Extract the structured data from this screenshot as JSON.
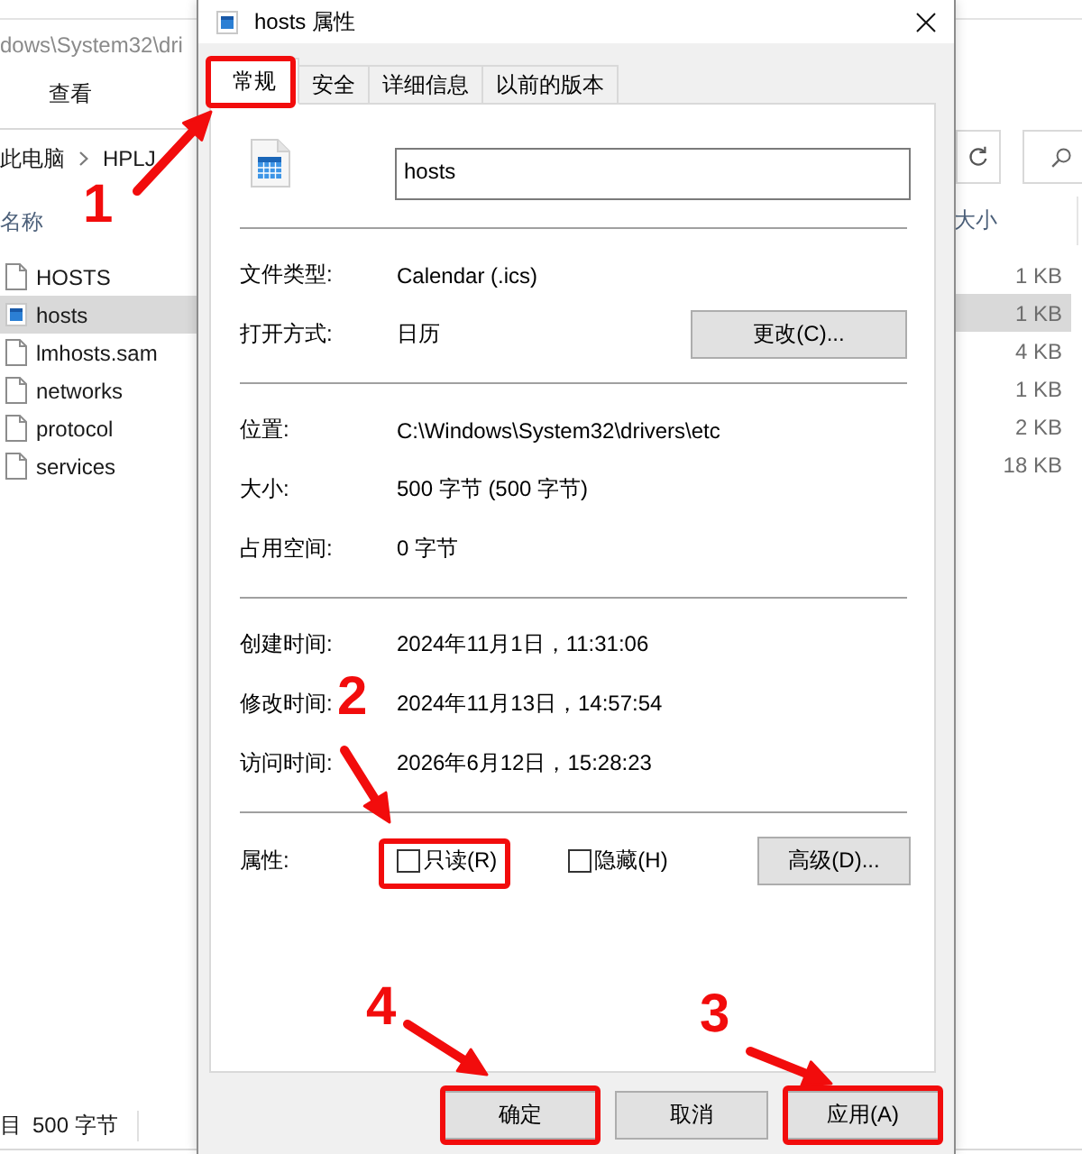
{
  "explorer": {
    "title": "dows\\System32\\dri",
    "ribbon_tabs": [
      "查看"
    ],
    "breadcrumb": [
      "此电脑",
      "HPLJ"
    ],
    "columns": [
      "名称",
      "大小"
    ],
    "files": [
      {
        "name": "HOSTS",
        "kind": "document",
        "size": "1 KB",
        "selected": false
      },
      {
        "name": "hosts",
        "kind": "calendar",
        "size": "1 KB",
        "selected": true
      },
      {
        "name": "lmhosts.sam",
        "kind": "document",
        "size": "4 KB",
        "selected": false
      },
      {
        "name": "networks",
        "kind": "document",
        "size": "1 KB",
        "selected": false
      },
      {
        "name": "protocol",
        "kind": "document",
        "size": "2 KB",
        "selected": false
      },
      {
        "name": "services",
        "kind": "document",
        "size": "18 KB",
        "selected": false
      }
    ],
    "status_bar": [
      "目",
      "500 字节"
    ]
  },
  "dialog": {
    "title": "hosts 属性",
    "tabs": [
      {
        "label": "常规",
        "selected": true,
        "highlighted": true
      },
      {
        "label": "安全",
        "selected": false,
        "highlighted": false
      },
      {
        "label": "详细信息",
        "selected": false,
        "highlighted": false
      },
      {
        "label": "以前的版本",
        "selected": false,
        "highlighted": false
      }
    ],
    "file_name": "hosts",
    "sections": [
      {
        "rows": [
          {
            "label": "文件类型:",
            "value": "Calendar (.ics)"
          },
          {
            "label": "打开方式:",
            "value": "日历",
            "button": "更改(C)..."
          }
        ]
      },
      {
        "rows": [
          {
            "label": "位置:",
            "value": "C:\\Windows\\System32\\drivers\\etc"
          },
          {
            "label": "大小:",
            "value": "500 字节 (500 字节)"
          },
          {
            "label": "占用空间:",
            "value": "0 字节"
          }
        ]
      },
      {
        "rows": [
          {
            "label": "创建时间:",
            "value": "2024年11月1日，11:31:06"
          },
          {
            "label": "修改时间:",
            "value": "2024年11月13日，14:57:54"
          },
          {
            "label": "访问时间:",
            "value": "2026年6月12日，15:28:23"
          }
        ]
      }
    ],
    "attributes": {
      "label": "属性:",
      "options": [
        {
          "label": "只读(R)",
          "checked": false,
          "highlighted": true
        },
        {
          "label": "隐藏(H)",
          "checked": false,
          "highlighted": false
        }
      ],
      "button": "高级(D)..."
    },
    "buttons": [
      {
        "label": "确定",
        "highlighted": true
      },
      {
        "label": "取消",
        "highlighted": false
      },
      {
        "label": "应用(A)",
        "highlighted": true
      }
    ]
  },
  "callouts": [
    {
      "number": "1"
    },
    {
      "number": "2"
    },
    {
      "number": "3"
    },
    {
      "number": "4"
    }
  ]
}
